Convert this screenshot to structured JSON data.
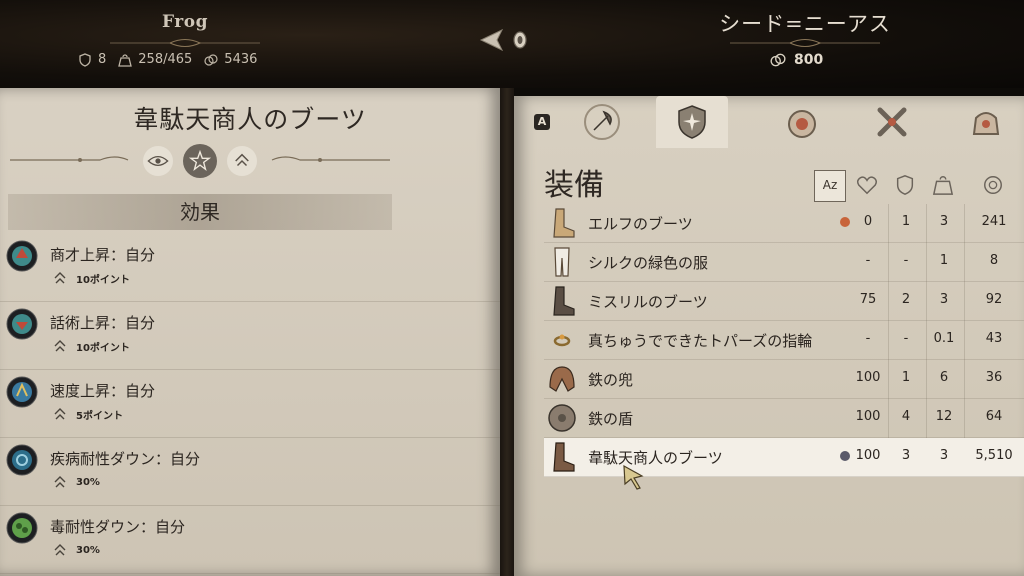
{
  "player": {
    "name": "Frog",
    "stats": [
      {
        "icon": "shield-icon",
        "value": "8"
      },
      {
        "icon": "weight-icon",
        "value": "258/465"
      },
      {
        "icon": "coin-icon",
        "value": "5436"
      }
    ]
  },
  "merchant": {
    "name": "シード=ニーアス",
    "gold": "800"
  },
  "item_detail": {
    "title": "韋駄天商人のブーツ",
    "tabs": [
      "eye-icon",
      "star-emblem-icon",
      "upgrade-icon"
    ],
    "section_label": "効果",
    "effects": [
      {
        "name": "商才上昇：自分",
        "value": "10ポイント",
        "color": "#3f8a8a"
      },
      {
        "name": "話術上昇：自分",
        "value": "10ポイント",
        "color": "#c04a3a"
      },
      {
        "name": "速度上昇：自分",
        "value": "5ポイント",
        "color": "#3a7aa0"
      },
      {
        "name": "疾病耐性ダウン：自分",
        "value": "30%",
        "color": "#2d6e8a"
      },
      {
        "name": "毒耐性ダウン：自分",
        "value": "30%",
        "color": "#5fa04a"
      }
    ]
  },
  "shop": {
    "key_hint": "A",
    "category_tabs": [
      "axe-icon",
      "shield-emblem-icon",
      "potion-icon",
      "tools-icon",
      "bag-icon"
    ],
    "active_tab": 1,
    "section_title": "装備",
    "sort_label": "Az",
    "columns": [
      "heart-icon",
      "shield-icon",
      "weight-icon",
      "coin-icon"
    ],
    "items": [
      {
        "name": "エルフのブーツ",
        "icon": "boots-icon",
        "gem": "#c8643a",
        "hp": "0",
        "armor": "1",
        "weight": "3",
        "price": "241"
      },
      {
        "name": "シルクの緑色の服",
        "icon": "pants-icon",
        "gem": "",
        "hp": "-",
        "armor": "-",
        "weight": "1",
        "price": "8"
      },
      {
        "name": "ミスリルのブーツ",
        "icon": "boots-icon",
        "gem": "",
        "hp": "75",
        "armor": "2",
        "weight": "3",
        "price": "92"
      },
      {
        "name": "真ちゅうでできたトパーズの指輪",
        "icon": "ring-icon",
        "gem": "",
        "hp": "-",
        "armor": "-",
        "weight": "0.1",
        "price": "43"
      },
      {
        "name": "鉄の兜",
        "icon": "helmet-icon",
        "gem": "",
        "hp": "100",
        "armor": "1",
        "weight": "6",
        "price": "36"
      },
      {
        "name": "鉄の盾",
        "icon": "round-shield-icon",
        "gem": "",
        "hp": "100",
        "armor": "4",
        "weight": "12",
        "price": "64"
      },
      {
        "name": "韋駄天商人のブーツ",
        "icon": "boots-icon",
        "gem": "#5a5a6a",
        "hp": "100",
        "armor": "3",
        "weight": "3",
        "price": "5,510",
        "selected": true
      }
    ]
  }
}
